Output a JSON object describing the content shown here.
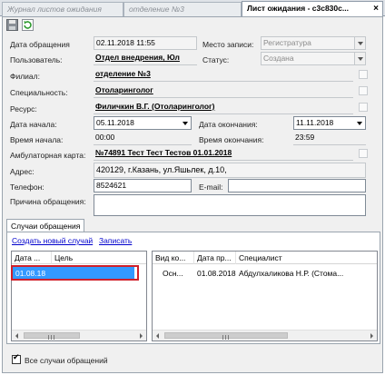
{
  "tabs": [
    {
      "label": "Журнал листов ожидания",
      "active": false
    },
    {
      "label": "отделение №3",
      "active": false
    },
    {
      "label": "Лист ожидания - c3c830c...",
      "active": true
    }
  ],
  "tab_close": "×",
  "icons": {
    "save": "save-icon",
    "refresh": "refresh-icon"
  },
  "form": {
    "date_label": "Дата обращения",
    "date_value": "02.11.2018 11:55",
    "place_label": "Место записи:",
    "place_value": "Регистратура",
    "user_label": "Пользователь:",
    "user_value": "Отдел внедрения, Юл",
    "status_label": "Статус:",
    "status_value": "Создана",
    "branch_label": "Филиал:",
    "branch_value": "отделение №3",
    "specialty_label": "Специальность:",
    "specialty_value": "Отоларинголог",
    "resource_label": "Ресурс:",
    "resource_value": "Филичкин В.Г. (Отоларинголог)",
    "start_date_label": "Дата начала:",
    "start_date_value": "05.11.2018",
    "end_date_label": "Дата окончания:",
    "end_date_value": "11.11.2018",
    "start_time_label": "Время начала:",
    "start_time_value": "00:00",
    "end_time_label": "Время окончания:",
    "end_time_value": "23:59",
    "card_label": "Амбулаторная карта:",
    "card_value": "№74891 Тест Тест Тестов 01.01.2018",
    "address_label": "Адрес:",
    "address_value": "420129, г.Казань, ул.Яшьлек, д.10,",
    "phone_label": "Телефон:",
    "phone_value": "8524621",
    "email_label": "E-mail:",
    "email_value": "",
    "reason_label": "Причина обращения:",
    "reason_value": ""
  },
  "cases": {
    "tab_label": "Случаи обращения",
    "create_link": "Создать новый случай",
    "save_link": "Записать",
    "left_grid": {
      "columns": [
        "Дата ...",
        "Цель"
      ],
      "rows": [
        [
          "01.08.18",
          ""
        ]
      ]
    },
    "right_grid": {
      "columns": [
        "Вид ко...",
        "Дата пр...",
        "Специалист"
      ],
      "rows": [
        [
          "Осн...",
          "01.08.2018",
          "Абдулхаликова Н.Р. (Стома..."
        ]
      ]
    },
    "all_cases_label": "Все случаи обращений",
    "all_cases_checked": true
  },
  "colors": {
    "selection": "#3399ff",
    "highlight_border": "#d0202a",
    "link": "#0000cc"
  }
}
